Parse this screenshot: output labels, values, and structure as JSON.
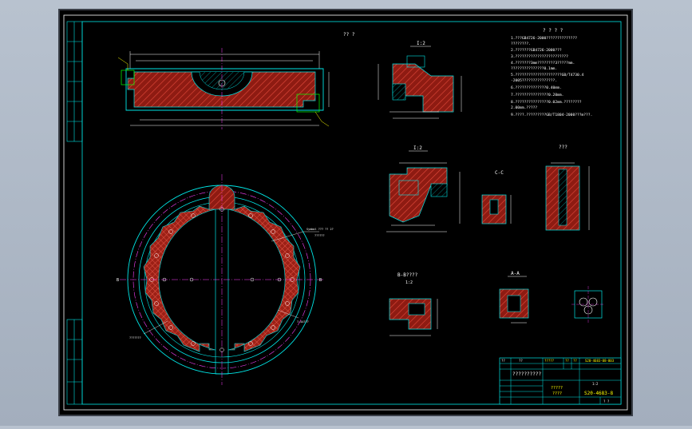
{
  "drawing": {
    "top_label": "?? ?",
    "colors": {
      "background": "#000000",
      "frame": "#ffffff",
      "outline": "#00e5e5",
      "hatch": "#c0392b",
      "annotation": "#ffffff",
      "title_text": "#ffff00",
      "center_line": "#ff40ff",
      "leader": "#ffff00"
    },
    "section_labels": {
      "detail1": "I:2",
      "detail2": "I:2",
      "cc": "C-C",
      "rr": "???",
      "bb": "B-B????",
      "bb_scale": "1:2",
      "aa": "A-A"
    },
    "notes_title": "? ? ? ?",
    "notes": [
      "1.???GB4726-2000??????????????",
      "  ????????.",
      "2.???????GB4726-2000???",
      "3.????????????????????????",
      "4.???????3mm????????3?????mm.",
      "  ???????????????0.1mm.",
      "5.?????????????????????GB/T4730.4",
      "  -2005???????????????.",
      "6.??????????????0.40mm.",
      "7.???????????????0.20mm.",
      "8.???????????????0.02mm.????????",
      "  2.00mm.?????",
      "9.????.?????????GB/T1804-2000???m???."
    ],
    "callouts": {
      "plate_right": "Symbol ??? ?? 2?",
      "plate_right_2": "??????",
      "plate_bottom_right": "?-44???",
      "plate_left": "???????"
    },
    "title_block": {
      "header_cells": [
        "??",
        "??",
        "?????",
        "??",
        "??",
        "??"
      ],
      "header_codes": [
        "S20-4683-08-003"
      ],
      "part_name": "??????????",
      "material": "?????",
      "material_2": "????",
      "drawing_number": "S20-4683-8",
      "scale_label": "1:2",
      "sheet": "? ?"
    },
    "left_strip_cells": [
      "",
      "",
      "",
      "",
      "",
      ""
    ]
  }
}
